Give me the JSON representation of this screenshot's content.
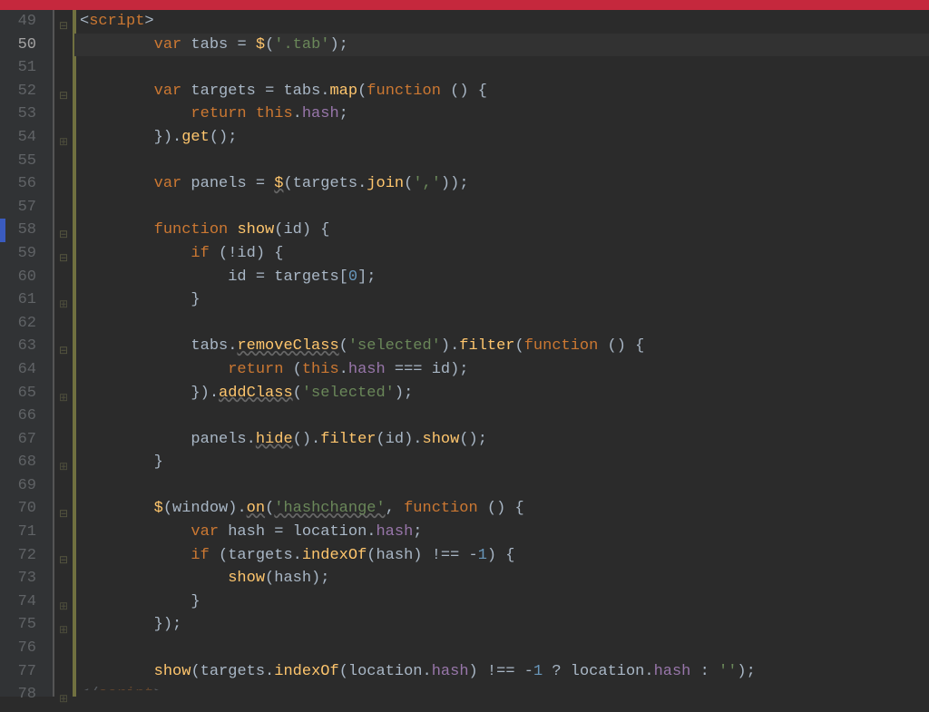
{
  "editor": {
    "highlight_line_index": 1,
    "lines": [
      {
        "num": 49,
        "fold": "open",
        "tokens": [
          {
            "c": "op",
            "t": "<"
          },
          {
            "c": "kw",
            "t": "script"
          },
          {
            "c": "op",
            "t": ">"
          }
        ],
        "indent": 0
      },
      {
        "num": 50,
        "fold": "",
        "tokens": [
          {
            "c": "kw",
            "t": "var"
          },
          {
            "c": "op",
            "t": " tabs "
          },
          {
            "c": "op",
            "t": "= "
          },
          {
            "c": "fn",
            "t": "$"
          },
          {
            "c": "op",
            "t": "("
          },
          {
            "c": "str",
            "t": "'.tab'"
          },
          {
            "c": "op",
            "t": ");"
          }
        ],
        "indent": 2
      },
      {
        "num": 51,
        "fold": "",
        "tokens": [],
        "indent": 0
      },
      {
        "num": 52,
        "fold": "open",
        "tokens": [
          {
            "c": "kw",
            "t": "var"
          },
          {
            "c": "op",
            "t": " targets "
          },
          {
            "c": "op",
            "t": "= tabs."
          },
          {
            "c": "fn",
            "t": "map"
          },
          {
            "c": "op",
            "t": "("
          },
          {
            "c": "kw",
            "t": "function"
          },
          {
            "c": "op",
            "t": " () {"
          }
        ],
        "indent": 2
      },
      {
        "num": 53,
        "fold": "",
        "tokens": [
          {
            "c": "kw",
            "t": "return"
          },
          {
            "c": "op",
            "t": " "
          },
          {
            "c": "this",
            "t": "this"
          },
          {
            "c": "op",
            "t": "."
          },
          {
            "c": "prop",
            "t": "hash"
          },
          {
            "c": "op",
            "t": ";"
          }
        ],
        "indent": 3
      },
      {
        "num": 54,
        "fold": "close",
        "tokens": [
          {
            "c": "op",
            "t": "})."
          },
          {
            "c": "fn",
            "t": "get"
          },
          {
            "c": "op",
            "t": "();"
          }
        ],
        "indent": 2
      },
      {
        "num": 55,
        "fold": "",
        "tokens": [],
        "indent": 0
      },
      {
        "num": 56,
        "fold": "",
        "tokens": [
          {
            "c": "kw",
            "t": "var"
          },
          {
            "c": "op",
            "t": " panels "
          },
          {
            "c": "op",
            "t": "= "
          },
          {
            "c": "fn squig",
            "t": "$"
          },
          {
            "c": "op",
            "t": "(targets."
          },
          {
            "c": "fn",
            "t": "join"
          },
          {
            "c": "op",
            "t": "("
          },
          {
            "c": "str",
            "t": "','"
          },
          {
            "c": "op",
            "t": "));"
          }
        ],
        "indent": 2
      },
      {
        "num": 57,
        "fold": "",
        "tokens": [],
        "indent": 0
      },
      {
        "num": 58,
        "fold": "open",
        "tokens": [
          {
            "c": "kw",
            "t": "function"
          },
          {
            "c": "op",
            "t": " "
          },
          {
            "c": "fn",
            "t": "show"
          },
          {
            "c": "op",
            "t": "(id) {"
          }
        ],
        "indent": 2,
        "blue": true
      },
      {
        "num": 59,
        "fold": "open",
        "tokens": [
          {
            "c": "kw",
            "t": "if"
          },
          {
            "c": "op",
            "t": " (!id) {"
          }
        ],
        "indent": 3
      },
      {
        "num": 60,
        "fold": "",
        "tokens": [
          {
            "c": "op",
            "t": "id = targets["
          },
          {
            "c": "num",
            "t": "0"
          },
          {
            "c": "op",
            "t": "];"
          }
        ],
        "indent": 4
      },
      {
        "num": 61,
        "fold": "close",
        "tokens": [
          {
            "c": "op",
            "t": "}"
          }
        ],
        "indent": 3
      },
      {
        "num": 62,
        "fold": "",
        "tokens": [],
        "indent": 0
      },
      {
        "num": 63,
        "fold": "open",
        "tokens": [
          {
            "c": "op",
            "t": "tabs."
          },
          {
            "c": "fn squig",
            "t": "removeClass"
          },
          {
            "c": "op",
            "t": "("
          },
          {
            "c": "str",
            "t": "'selected'"
          },
          {
            "c": "op",
            "t": ")."
          },
          {
            "c": "fn",
            "t": "filter"
          },
          {
            "c": "op",
            "t": "("
          },
          {
            "c": "kw",
            "t": "function"
          },
          {
            "c": "op",
            "t": " () {"
          }
        ],
        "indent": 3
      },
      {
        "num": 64,
        "fold": "",
        "tokens": [
          {
            "c": "kw",
            "t": "return"
          },
          {
            "c": "op",
            "t": " ("
          },
          {
            "c": "this",
            "t": "this"
          },
          {
            "c": "op",
            "t": "."
          },
          {
            "c": "prop",
            "t": "hash"
          },
          {
            "c": "op",
            "t": " === id);"
          }
        ],
        "indent": 4
      },
      {
        "num": 65,
        "fold": "close",
        "tokens": [
          {
            "c": "op",
            "t": "})."
          },
          {
            "c": "fn squig",
            "t": "addClass"
          },
          {
            "c": "op",
            "t": "("
          },
          {
            "c": "str",
            "t": "'selected'"
          },
          {
            "c": "op",
            "t": ");"
          }
        ],
        "indent": 3
      },
      {
        "num": 66,
        "fold": "",
        "tokens": [],
        "indent": 0
      },
      {
        "num": 67,
        "fold": "",
        "tokens": [
          {
            "c": "op",
            "t": "panels."
          },
          {
            "c": "fn squig",
            "t": "hide"
          },
          {
            "c": "op",
            "t": "()."
          },
          {
            "c": "fn",
            "t": "filter"
          },
          {
            "c": "op",
            "t": "(id)."
          },
          {
            "c": "fn",
            "t": "show"
          },
          {
            "c": "op",
            "t": "();"
          }
        ],
        "indent": 3
      },
      {
        "num": 68,
        "fold": "close",
        "tokens": [
          {
            "c": "op",
            "t": "}"
          }
        ],
        "indent": 2
      },
      {
        "num": 69,
        "fold": "",
        "tokens": [],
        "indent": 0
      },
      {
        "num": 70,
        "fold": "open",
        "tokens": [
          {
            "c": "fn",
            "t": "$"
          },
          {
            "c": "op",
            "t": "(window)."
          },
          {
            "c": "fn squig",
            "t": "on"
          },
          {
            "c": "op",
            "t": "("
          },
          {
            "c": "str squig",
            "t": "'hashchange'"
          },
          {
            "c": "op",
            "t": ", "
          },
          {
            "c": "kw",
            "t": "function"
          },
          {
            "c": "op",
            "t": " () {"
          }
        ],
        "indent": 2
      },
      {
        "num": 71,
        "fold": "",
        "tokens": [
          {
            "c": "kw",
            "t": "var"
          },
          {
            "c": "op",
            "t": " hash "
          },
          {
            "c": "op",
            "t": "= location."
          },
          {
            "c": "prop",
            "t": "hash"
          },
          {
            "c": "op",
            "t": ";"
          }
        ],
        "indent": 3
      },
      {
        "num": 72,
        "fold": "open",
        "tokens": [
          {
            "c": "kw",
            "t": "if"
          },
          {
            "c": "op",
            "t": " (targets."
          },
          {
            "c": "fn",
            "t": "indexOf"
          },
          {
            "c": "op",
            "t": "(hash) !== -"
          },
          {
            "c": "num",
            "t": "1"
          },
          {
            "c": "op",
            "t": ") {"
          }
        ],
        "indent": 3
      },
      {
        "num": 73,
        "fold": "",
        "tokens": [
          {
            "c": "fn",
            "t": "show"
          },
          {
            "c": "op",
            "t": "(hash);"
          }
        ],
        "indent": 4
      },
      {
        "num": 74,
        "fold": "close",
        "tokens": [
          {
            "c": "op",
            "t": "}"
          }
        ],
        "indent": 3
      },
      {
        "num": 75,
        "fold": "close",
        "tokens": [
          {
            "c": "op",
            "t": "});"
          }
        ],
        "indent": 2
      },
      {
        "num": 76,
        "fold": "",
        "tokens": [],
        "indent": 0
      },
      {
        "num": 77,
        "fold": "",
        "tokens": [
          {
            "c": "fn",
            "t": "show"
          },
          {
            "c": "op",
            "t": "(targets."
          },
          {
            "c": "fn",
            "t": "indexOf"
          },
          {
            "c": "op",
            "t": "(location."
          },
          {
            "c": "prop",
            "t": "hash"
          },
          {
            "c": "op",
            "t": ") !== -"
          },
          {
            "c": "num",
            "t": "1"
          },
          {
            "c": "op",
            "t": " ? location."
          },
          {
            "c": "prop",
            "t": "hash"
          },
          {
            "c": "op",
            "t": " : "
          },
          {
            "c": "str",
            "t": "''"
          },
          {
            "c": "op",
            "t": ");"
          }
        ],
        "indent": 2
      },
      {
        "num": 78,
        "fold": "close",
        "tokens": [
          {
            "c": "op",
            "t": "</"
          },
          {
            "c": "kw",
            "t": "script"
          },
          {
            "c": "op",
            "t": ">"
          }
        ],
        "indent": 0,
        "partial": true
      }
    ]
  }
}
